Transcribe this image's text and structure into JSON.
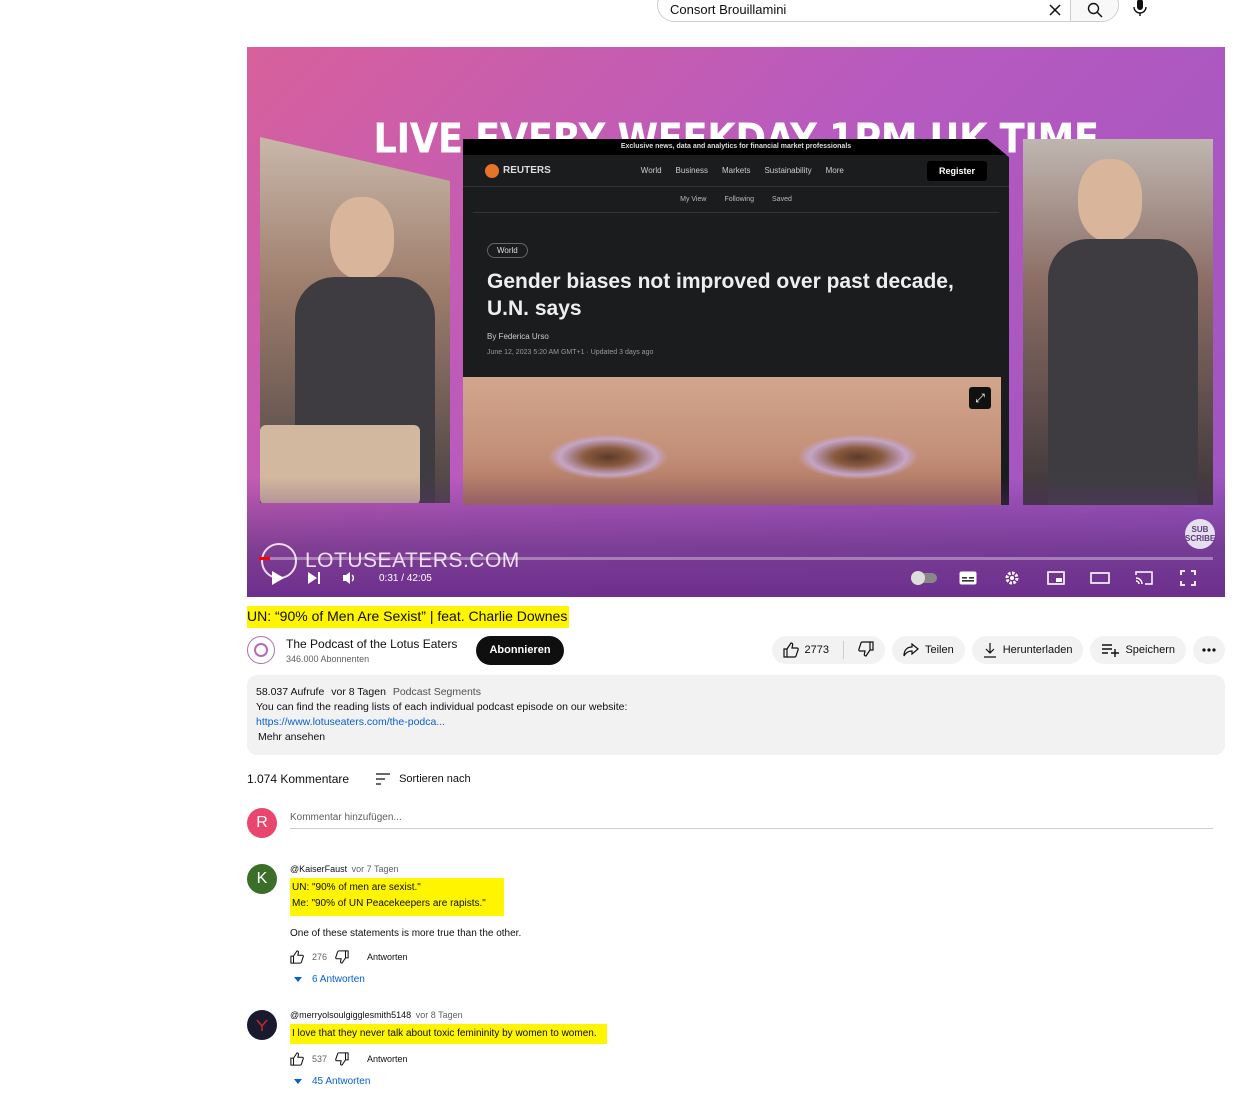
{
  "search": {
    "query": "Consort Brouillamini"
  },
  "video": {
    "banner": "LIVE EVERY WEEKDAY 1PM UK TIME",
    "article": {
      "top_bar": "Exclusive news, data and analytics for financial market professionals",
      "logo": "REUTERS",
      "menu": [
        "World",
        "Business",
        "Markets",
        "Sustainability",
        "More"
      ],
      "register": "Register",
      "sub_nav": [
        "My View",
        "Following",
        "Saved"
      ],
      "tag": "World",
      "headline": "Gender biases not improved over past decade, U.N. says",
      "byline": "By Federica Urso",
      "date": "June 12, 2023 5:20 AM GMT+1 · Updated 3 days ago"
    },
    "watermark": "LOTUSEATERS.COM",
    "subscribe_badge": "SUB SCRIBE",
    "time": "0:31 / 42:05",
    "progress": 0.012
  },
  "title": "UN: “90% of Men Are Sexist” | feat. Charlie Downes",
  "channel": {
    "name": "The Podcast of the Lotus Eaters",
    "subscribers": "346.000 Abonnenten",
    "subscribe_label": "Abonnieren"
  },
  "actions": {
    "likes": "2773",
    "share": "Teilen",
    "download": "Herunterladen",
    "save": "Speichern"
  },
  "description": {
    "views": "58.037 Aufrufe",
    "age": "vor 8 Tagen",
    "category": "Podcast Segments",
    "text": "You can find the reading lists of each individual podcast episode on our website:",
    "link": "https://www.lotuseaters.com/the-podca...",
    "more": "Mehr ansehen"
  },
  "comments_section": {
    "count": "1.074 Kommentare",
    "sort_label": "Sortieren nach",
    "add_placeholder": "Kommentar hinzufügen...",
    "user_initial": "R",
    "user_color": "#e8466e"
  },
  "comments": [
    {
      "initial": "K",
      "avatar_color": "#3a6e29",
      "author": "@KaiserFaust",
      "when": "vor 7 Tagen",
      "line1": "UN: \"90% of men are sexist.\"",
      "line2": "Me: \"90% of UN Peacekeepers are rapists.\"",
      "line3": "One of these statements is more true than the other.",
      "likes": "276",
      "reply": "Antworten",
      "replies": "6 Antworten"
    },
    {
      "initial": "",
      "avatar_color": "#1a1a2e",
      "author": "@merryolsoulgigglesmith5148",
      "when": "vor 8 Tagen",
      "line1": "I love that they never talk about toxic femininity by women to women.",
      "likes": "537",
      "reply": "Antworten",
      "replies": "45 Antworten"
    }
  ]
}
